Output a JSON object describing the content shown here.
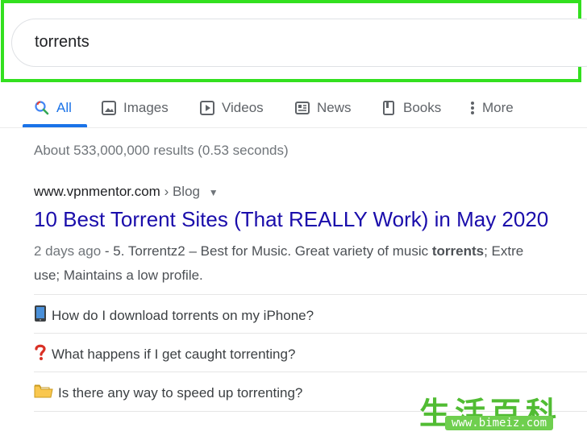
{
  "search": {
    "query": "torrents"
  },
  "tabs": [
    {
      "label": "All",
      "icon": "search-icon",
      "active": true
    },
    {
      "label": "Images",
      "icon": "image-icon"
    },
    {
      "label": "Videos",
      "icon": "play-icon"
    },
    {
      "label": "News",
      "icon": "news-icon"
    },
    {
      "label": "Books",
      "icon": "book-icon"
    },
    {
      "label": "More",
      "icon": "more-vert-icon"
    }
  ],
  "stats": "About 533,000,000 results (0.53 seconds)",
  "result": {
    "site": "www.vpnmentor.com",
    "crumb": "› Blog",
    "title": "10 Best Torrent Sites (That REALLY Work) in May 2020",
    "date": "2 days ago",
    "snippet_part1": " - 5. Torrentz2 – Best for Music. Great variety of music ",
    "snippet_bold": "torrents",
    "snippet_part2": "; Extre",
    "snippet_line2": "use; Maintains a low profile."
  },
  "questions": [
    {
      "text": "How do I download torrents on my iPhone?",
      "icon": "phone-icon"
    },
    {
      "text": "What happens if I get caught torrenting?",
      "icon": "question-icon"
    },
    {
      "text": "Is there any way to speed up torrenting?",
      "icon": "folder-icon"
    }
  ],
  "watermark": {
    "chars": "生活百科",
    "url": "www.bimeiz.com"
  },
  "colors": {
    "highlight": "#33e01f",
    "link": "#1a0dab",
    "accent": "#1a73e8"
  }
}
